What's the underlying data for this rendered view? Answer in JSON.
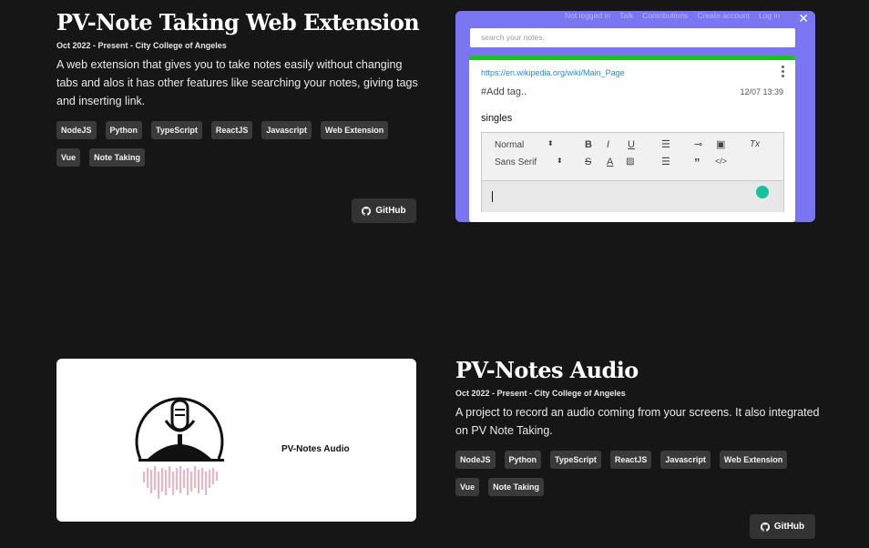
{
  "project1": {
    "title": "PV-Note Taking Web Extension",
    "meta": "Oct 2022 - Present - City College of Angeles",
    "description": "A web extension that gives you to take notes easily without changing tabs and alos it has other features like searching your notes, giving tags and inserting link.",
    "tags": [
      "NodeJS",
      "Python",
      "TypeScript",
      "ReactJS",
      "Javascript",
      "Web Extension",
      "Vue",
      "Note Taking"
    ],
    "github_label": "GitHub",
    "screenshot": {
      "wiki_links": [
        "Not logged in",
        "Talk",
        "Contributions",
        "Create account",
        "Log in"
      ],
      "search_placeholder": "search your notes.",
      "url": "https://en.wikipedia.org/wiki/Main_Page",
      "add_tag": "#Add tag..",
      "date": "12/07 13:39",
      "note_text": "singles",
      "font_size_option": "Normal",
      "font_family_option": "Sans Serif"
    }
  },
  "project2": {
    "title": "PV-Notes Audio",
    "meta": "Oct 2022 - Present - City College of Angeles",
    "description": "A project to record an audio coming from your screens. It also integrated on PV Note Taking.",
    "tags": [
      "NodeJS",
      "Python",
      "TypeScript",
      "ReactJS",
      "Javascript",
      "Web Extension",
      "Vue",
      "Note Taking"
    ],
    "github_label": "GitHub",
    "logo_text": "PV-Notes Audio"
  }
}
